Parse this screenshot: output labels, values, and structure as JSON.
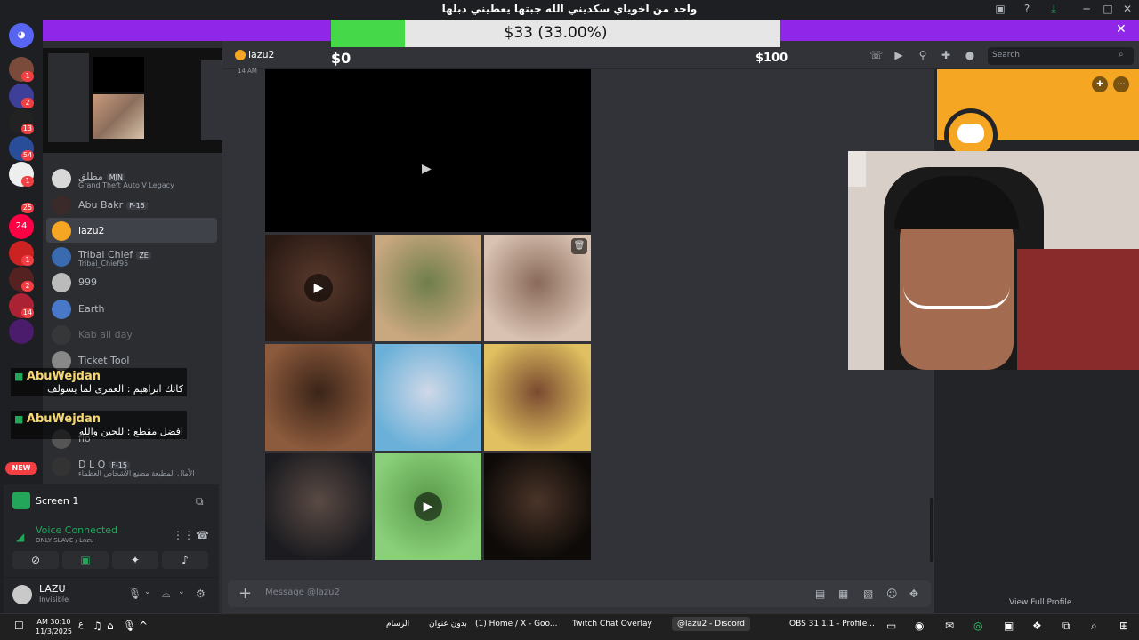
{
  "window": {
    "title": "واحد من اخوياي سكديني الله جبتها يعطيني دبلها"
  },
  "donation": {
    "label": "$33 (33.00%)",
    "progress": 0.33,
    "min": "$0",
    "max": "$100"
  },
  "servers": [
    {
      "badge": "1"
    },
    {
      "badge": "2"
    },
    {
      "badge": "13"
    },
    {
      "badge": "54"
    },
    {
      "badge": "1"
    },
    {
      "badge": "25"
    },
    {
      "label": "24"
    },
    {
      "badge": "1"
    },
    {
      "badge": "2"
    },
    {
      "badge": "14"
    },
    {
      "badge": ""
    }
  ],
  "new_badge": "NEW",
  "dms": [
    {
      "name": "مطلق",
      "tag": "MJN",
      "sub": "Grand Theft Auto V Legacy"
    },
    {
      "name": "Abu Bakr",
      "tag": "F-15",
      "sub": ""
    },
    {
      "name": "lazu2",
      "tag": "",
      "sub": ""
    },
    {
      "name": "Tribal Chief",
      "tag": "ZE",
      "sub": "Tribal_Chief95"
    },
    {
      "name": "999",
      "tag": "",
      "sub": ""
    },
    {
      "name": "Earth",
      "tag": "",
      "sub": ""
    },
    {
      "name": "Kab all day",
      "tag": "",
      "sub": ""
    },
    {
      "name": "Ticket Tool",
      "tag": "",
      "sub": ""
    },
    {
      "name": "flo",
      "tag": "",
      "sub": ""
    },
    {
      "name": "D L Q",
      "tag": "F-15",
      "sub": "الأمال المطيعة مصنع الأشخاص العظماء"
    }
  ],
  "chat_overlay": [
    {
      "user": "AbuWejdan",
      "text": "كاتك ابراهيم : العمرى لما يسولف"
    },
    {
      "user": "AbuWejdan",
      "text": "افضل مقطع : للحين والله"
    }
  ],
  "voice": {
    "screen_label": "Screen 1",
    "status": "Voice Connected",
    "channel": "ONLY SLAVE / Lazu",
    "username": "LAZU",
    "user_status": "Invisible"
  },
  "header": {
    "dm_name": "lazu2",
    "search_placeholder": "Search",
    "timestamp": "14 AM"
  },
  "message": {
    "placeholder": "Message @lazu2"
  },
  "profile": {
    "view_full": "View Full Profile"
  },
  "taskbar": {
    "time": "AM 30:10",
    "date": "11/3/2025",
    "lang": "ع",
    "apps": [
      "الرسام",
      "بدون عنوان",
      "(1) Home / X - Goo...",
      "Twitch Chat Overlay",
      "@lazu2 - Discord",
      "OBS 31.1.1 - Profile..."
    ]
  },
  "colors": {
    "discord_blurple": "#5865f2",
    "donation_bar": "#8f26e8",
    "progress_fill": "#45d94a",
    "profile_banner": "#f5a623"
  }
}
